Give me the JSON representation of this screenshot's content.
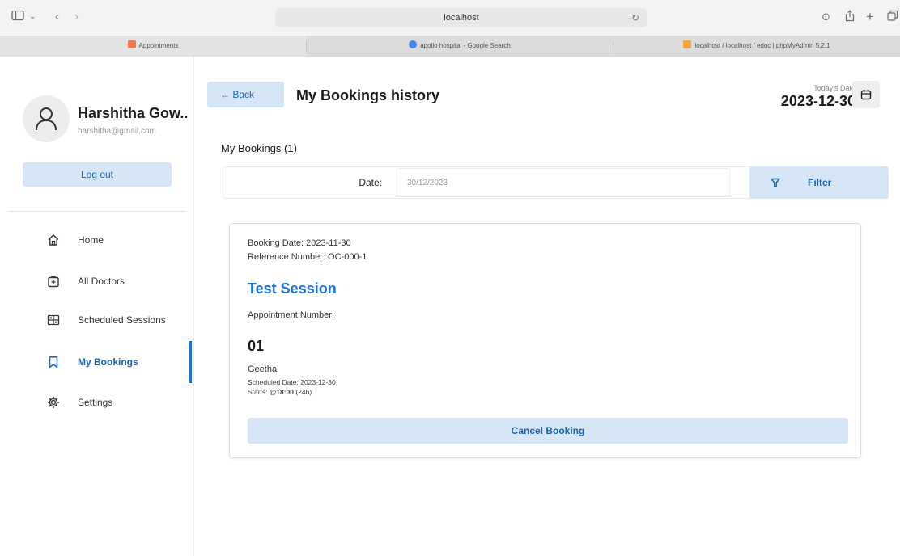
{
  "browser": {
    "address": "localhost",
    "tabs": [
      {
        "label": "Appointments",
        "favicon_color": "#f0784a"
      },
      {
        "label": "apollo hospital - Google Search",
        "favicon_color": "#4285f4"
      },
      {
        "label": "localhost / localhost / edoc | phpMyAdmin 5.2.1",
        "favicon_color": "#f2a33a"
      }
    ]
  },
  "sidebar": {
    "user_name": "Harshitha Gow..",
    "user_email": "harshitha@gmail.com",
    "logout_label": "Log out",
    "items": [
      {
        "label": "Home",
        "icon": "home-icon"
      },
      {
        "label": "All Doctors",
        "icon": "doctor-icon"
      },
      {
        "label": "Scheduled Sessions",
        "icon": "sessions-icon"
      },
      {
        "label": "My Bookings",
        "icon": "bookmark-icon",
        "active": true
      },
      {
        "label": "Settings",
        "icon": "gear-icon"
      }
    ]
  },
  "header": {
    "back_label": "← Back",
    "title": "My Bookings history",
    "today_label": "Today's Date",
    "today_value": "2023-12-30"
  },
  "bookings": {
    "count_label": "My Bookings (1)",
    "filter": {
      "date_label": "Date:",
      "date_value": "30/12/2023",
      "filter_label": "Filter"
    },
    "card": {
      "booking_date": "Booking Date: 2023-11-30",
      "reference": "Reference Number: OC-000-1",
      "session_title": "Test Session",
      "appointment_label": "Appointment Number:",
      "appointment_number": "01",
      "doctor": "Geetha",
      "scheduled": "Scheduled Date: 2023-12-30",
      "starts_prefix": "Starts: ",
      "starts_time": "@18:00",
      "starts_suffix": " (24h)",
      "cancel_label": "Cancel Booking"
    }
  },
  "colors": {
    "accent": "#1a73d9",
    "button_bg": "#d6e6f7",
    "button_text": "#1a63b0"
  }
}
